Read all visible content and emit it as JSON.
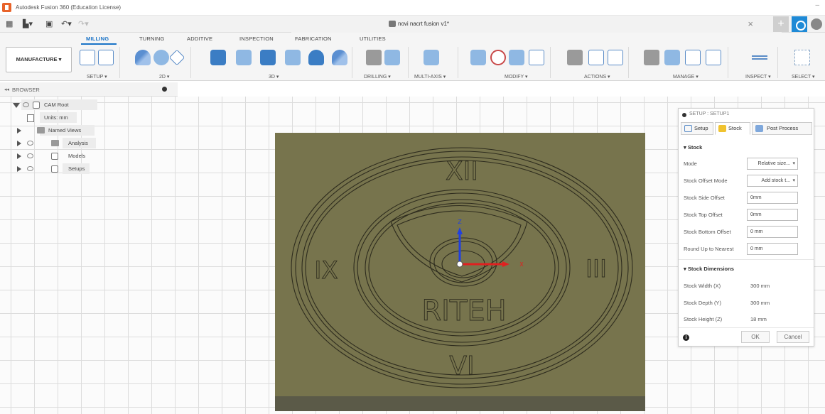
{
  "window": {
    "title": "Autodesk Fusion 360 (Education License)"
  },
  "document": {
    "title": "novi nacrt fusion v1*",
    "close_glyph": "×",
    "add_glyph": "+"
  },
  "ribbon": {
    "workspace": "MANUFACTURE ▾",
    "tabs": [
      "MILLING",
      "TURNING",
      "ADDITIVE",
      "INSPECTION",
      "FABRICATION",
      "UTILITIES"
    ],
    "active_tab": "MILLING",
    "groups": [
      "SETUP ▾",
      "2D ▾",
      "3D ▾",
      "DRILLING ▾",
      "MULTI-AXIS ▾",
      "MODIFY ▾",
      "ACTIONS ▾",
      "MANAGE ▾",
      "INSPECT ▾",
      "SELECT ▾"
    ]
  },
  "browser": {
    "title": "BROWSER",
    "collapse_glyph": "◂◂",
    "items": [
      {
        "label": "CAM Root"
      },
      {
        "label": "Units: mm"
      },
      {
        "label": "Named Views"
      },
      {
        "label": "Analysis"
      },
      {
        "label": "Models"
      },
      {
        "label": "Setups"
      }
    ]
  },
  "model": {
    "numerals": [
      "XII",
      "IX",
      "III",
      "VI"
    ],
    "logo_text": "RITEH",
    "axis_x": "X",
    "axis_z": "Z",
    "colors": {
      "stock": "#77744d",
      "stock_base": "#5b5a48",
      "axis_x": "#e02020",
      "axis_z": "#2040e0"
    }
  },
  "setup_panel": {
    "header": "SETUP : SETUP1",
    "tabs": [
      "Setup",
      "Stock",
      "Post Process"
    ],
    "active_tab": "Stock",
    "stock_section": "▾ Stock",
    "fields": [
      {
        "label": "Mode",
        "value": "Relative size..."
      },
      {
        "label": "Stock Offset Mode",
        "value": "Add stock t..."
      },
      {
        "label": "Stock Side Offset",
        "value": "0mm"
      },
      {
        "label": "Stock Top Offset",
        "value": "0mm"
      },
      {
        "label": "Stock Bottom Offset",
        "value": "0 mm"
      },
      {
        "label": "Round Up to Nearest",
        "value": "0 mm"
      }
    ],
    "dimensions_section": "▾ Stock Dimensions",
    "dimensions": [
      {
        "label": "Stock Width (X)",
        "value": "300 mm"
      },
      {
        "label": "Stock Depth (Y)",
        "value": "300 mm"
      },
      {
        "label": "Stock Height (Z)",
        "value": "18 mm"
      }
    ],
    "info_glyph": "i",
    "ok_label": "OK",
    "cancel_label": "Cancel"
  }
}
